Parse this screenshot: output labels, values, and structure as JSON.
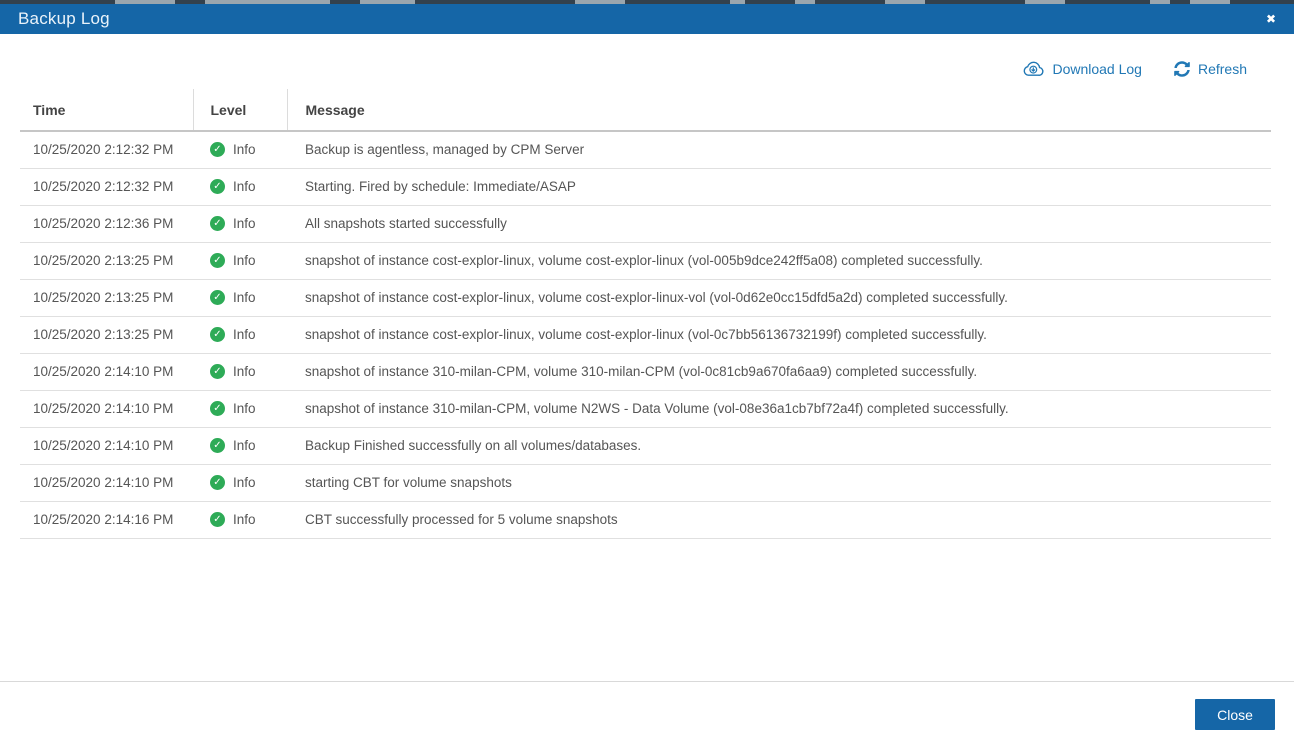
{
  "modal": {
    "title": "Backup Log",
    "close_glyph": "✖"
  },
  "toolbar": {
    "download_label": "Download Log",
    "refresh_label": "Refresh"
  },
  "icons": {
    "check_glyph": "✓"
  },
  "table": {
    "columns": [
      "Time",
      "Level",
      "Message"
    ],
    "rows": [
      {
        "time": "10/25/2020 2:12:32 PM",
        "level": "Info",
        "message": "Backup is agentless, managed by CPM Server"
      },
      {
        "time": "10/25/2020 2:12:32 PM",
        "level": "Info",
        "message": "Starting. Fired by schedule: Immediate/ASAP"
      },
      {
        "time": "10/25/2020 2:12:36 PM",
        "level": "Info",
        "message": "All snapshots started successfully"
      },
      {
        "time": "10/25/2020 2:13:25 PM",
        "level": "Info",
        "message": "snapshot of instance cost-explor-linux, volume cost-explor-linux (vol-005b9dce242ff5a08) completed successfully."
      },
      {
        "time": "10/25/2020 2:13:25 PM",
        "level": "Info",
        "message": "snapshot of instance cost-explor-linux, volume cost-explor-linux-vol (vol-0d62e0cc15dfd5a2d) completed successfully."
      },
      {
        "time": "10/25/2020 2:13:25 PM",
        "level": "Info",
        "message": "snapshot of instance cost-explor-linux, volume cost-explor-linux (vol-0c7bb56136732199f) completed successfully."
      },
      {
        "time": "10/25/2020 2:14:10 PM",
        "level": "Info",
        "message": "snapshot of instance 310-milan-CPM, volume 310-milan-CPM (vol-0c81cb9a670fa6aa9) completed successfully."
      },
      {
        "time": "10/25/2020 2:14:10 PM",
        "level": "Info",
        "message": "snapshot of instance 310-milan-CPM, volume N2WS - Data Volume (vol-08e36a1cb7bf72a4f) completed successfully."
      },
      {
        "time": "10/25/2020 2:14:10 PM",
        "level": "Info",
        "message": "Backup Finished successfully on all volumes/databases."
      },
      {
        "time": "10/25/2020 2:14:10 PM",
        "level": "Info",
        "message": "starting CBT for volume snapshots"
      },
      {
        "time": "10/25/2020 2:14:16 PM",
        "level": "Info",
        "message": "CBT successfully processed for 5 volume snapshots"
      }
    ]
  },
  "footer": {
    "close_label": "Close"
  },
  "colors": {
    "header_blue": "#1566a7",
    "link_blue": "#2178b5",
    "success_green": "#2eab57"
  }
}
